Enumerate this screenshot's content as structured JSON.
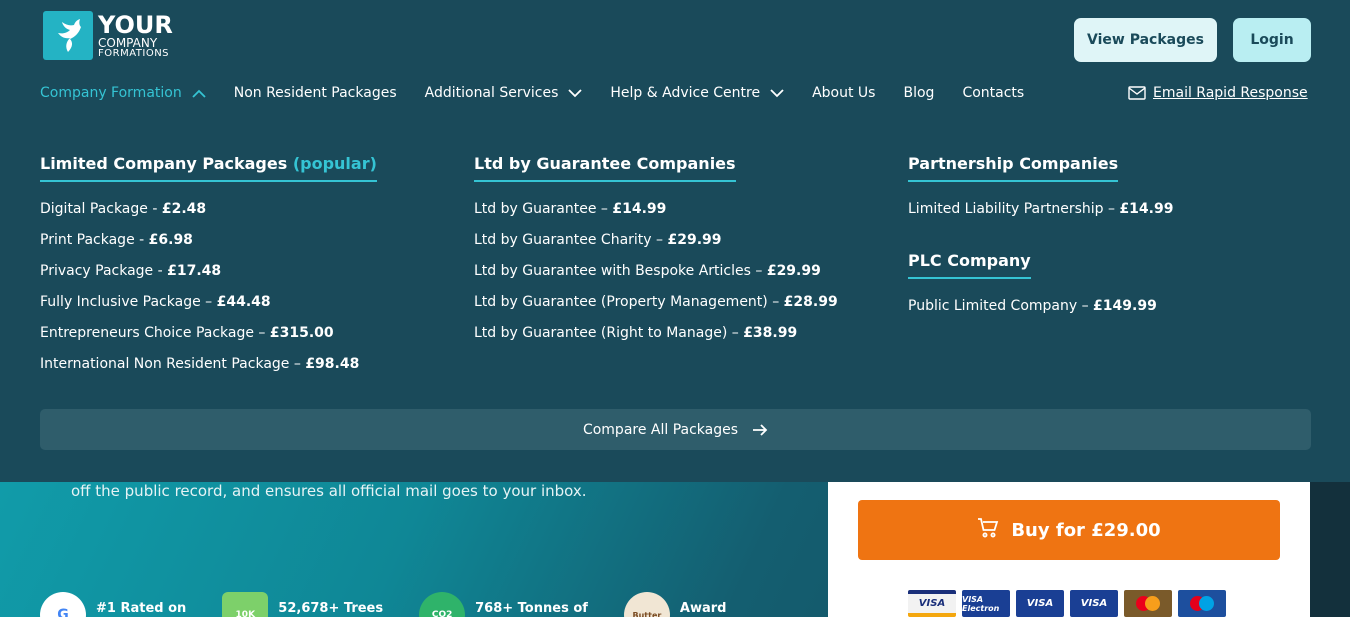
{
  "header": {
    "logo": {
      "line1": "YOUR",
      "line2": "COMPANY",
      "line3": "FORMATIONS"
    },
    "view_packages_label": "View Packages",
    "login_label": "Login"
  },
  "nav": {
    "items": [
      {
        "label": "Company Formation",
        "active": true,
        "dropdown": "up"
      },
      {
        "label": "Non Resident Packages"
      },
      {
        "label": "Additional Services",
        "dropdown": "down"
      },
      {
        "label": "Help & Advice Centre",
        "dropdown": "down"
      },
      {
        "label": "About Us"
      },
      {
        "label": "Blog"
      },
      {
        "label": "Contacts"
      }
    ],
    "email_label": "Email Rapid Response"
  },
  "mega_menu": {
    "col1": {
      "heading": "Limited Company Packages",
      "heading_tag": "(popular)",
      "items": [
        {
          "name": "Digital Package - ",
          "price": "£2.48"
        },
        {
          "name": "Print Package - ",
          "price": "£6.98"
        },
        {
          "name": "Privacy Package - ",
          "price": "£17.48"
        },
        {
          "name": "Fully Inclusive Package – ",
          "price": "£44.48"
        },
        {
          "name": "Entrepreneurs Choice Package – ",
          "price": "£315.00"
        },
        {
          "name": "International Non Resident Package – ",
          "price": "£98.48"
        }
      ]
    },
    "col2": {
      "heading": "Ltd by Guarantee Companies",
      "items": [
        {
          "name": "Ltd by Guarantee – ",
          "price": "£14.99"
        },
        {
          "name": "Ltd by Guarantee Charity – ",
          "price": "£29.99"
        },
        {
          "name": "Ltd by Guarantee with Bespoke Articles – ",
          "price": "£29.99"
        },
        {
          "name": "Ltd by Guarantee (Property Management) – ",
          "price": "£28.99"
        },
        {
          "name": "Ltd by Guarantee (Right to Manage) – ",
          "price": "£38.99"
        }
      ]
    },
    "col3": {
      "heading": "Partnership Companies",
      "items": [
        {
          "name": "Limited Liability Partnership – ",
          "price": "£14.99"
        }
      ],
      "heading2": "PLC Company",
      "items2": [
        {
          "name": "Public Limited Company – ",
          "price": "£149.99"
        }
      ]
    },
    "compare_label": "Compare All Packages"
  },
  "hero": {
    "subtitle": "off the public record, and ensures all official mail goes to your inbox.",
    "trust": [
      {
        "badge": "G",
        "text": "#1 Rated on"
      },
      {
        "badge": "10K",
        "text": "52,678+ Trees"
      },
      {
        "badge": "CO2",
        "text": "768+ Tonnes of"
      },
      {
        "badge": "Butter",
        "text": "Award"
      }
    ]
  },
  "buy": {
    "label": "Buy for £29.00",
    "cards": [
      "VISA",
      "VISA Electron",
      "VISA",
      "VISA",
      "mastercard",
      "maestro"
    ]
  },
  "colors": {
    "menu_bg": "#1a4a5a",
    "accent": "#35c4d4",
    "buy_orange": "#ef7412"
  }
}
